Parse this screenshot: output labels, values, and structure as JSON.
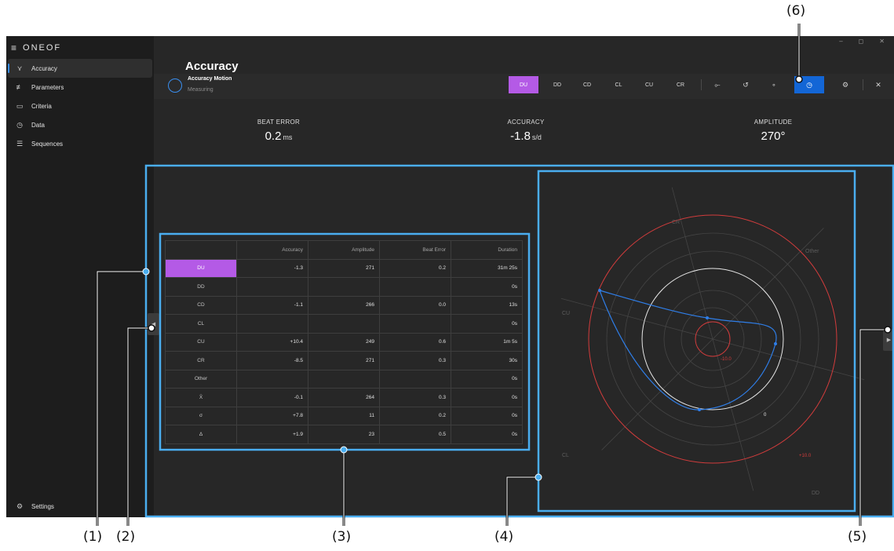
{
  "app": {
    "brand": "ONEOF"
  },
  "sidebar": {
    "items": [
      {
        "label": "Accuracy",
        "icon": "accuracy-icon",
        "active": true
      },
      {
        "label": "Parameters",
        "icon": "sliders-icon",
        "active": false
      },
      {
        "label": "Criteria",
        "icon": "monitor-icon",
        "active": false
      },
      {
        "label": "Data",
        "icon": "stopwatch-icon",
        "active": false
      },
      {
        "label": "Sequences",
        "icon": "list-icon",
        "active": false
      }
    ],
    "settings_label": "Settings"
  },
  "window_controls": [
    "–",
    "◻",
    "✕"
  ],
  "page": {
    "title": "Accuracy"
  },
  "header": {
    "motion_title": "Accuracy Motion",
    "motion_status": "Measuring",
    "positions": [
      "DU",
      "DD",
      "CD",
      "CL",
      "CU",
      "CR"
    ],
    "active_position": "DU",
    "tools": [
      "pin-icon",
      "history-icon",
      "dot-icon",
      "stopwatch-icon",
      "gear-icon",
      "close-icon"
    ]
  },
  "metrics": {
    "beat_error": {
      "label": "BEAT ERROR",
      "value": "0.2",
      "unit": "ms"
    },
    "accuracy": {
      "label": "ACCURACY",
      "value": "-1.8",
      "unit": "s/d"
    },
    "amplitude": {
      "label": "AMPLITUDE",
      "value": "270°",
      "unit": ""
    }
  },
  "table": {
    "headers": [
      "",
      "Accuracy",
      "Amplitude",
      "Beat Error",
      "Duration"
    ],
    "rows": [
      {
        "label": "DU",
        "accuracy": "-1.3",
        "amplitude": "271",
        "beat_error": "0.2",
        "duration": "31m 25s",
        "active": true
      },
      {
        "label": "DD",
        "accuracy": "",
        "amplitude": "",
        "beat_error": "",
        "duration": "0s"
      },
      {
        "label": "CD",
        "accuracy": "-1.1",
        "amplitude": "266",
        "beat_error": "0.0",
        "duration": "13s"
      },
      {
        "label": "CL",
        "accuracy": "",
        "amplitude": "",
        "beat_error": "",
        "duration": "0s"
      },
      {
        "label": "CU",
        "accuracy": "+10.4",
        "amplitude": "249",
        "beat_error": "0.6",
        "duration": "1m 5s"
      },
      {
        "label": "CR",
        "accuracy": "-8.5",
        "amplitude": "271",
        "beat_error": "0.3",
        "duration": "30s"
      },
      {
        "label": "Other",
        "accuracy": "",
        "amplitude": "",
        "beat_error": "",
        "duration": "0s"
      },
      {
        "label": "X̄",
        "accuracy": "-0.1",
        "amplitude": "264",
        "beat_error": "0.3",
        "duration": "0s"
      },
      {
        "label": "σ",
        "accuracy": "+7.8",
        "amplitude": "11",
        "beat_error": "0.2",
        "duration": "0s"
      },
      {
        "label": "Δ",
        "accuracy": "+1.9",
        "amplitude": "23",
        "beat_error": "0.5",
        "duration": "0s"
      }
    ]
  },
  "polar_chart": {
    "axes": [
      "CR",
      "Other",
      "CU",
      "CL",
      "DD"
    ],
    "ring_labels": {
      "inner": "-10.0",
      "zero": "0",
      "outer": "+10.0"
    },
    "colors": {
      "limit": "#d23c3c",
      "zero": "#e6e6e6",
      "trace": "#2f7ee8",
      "grid": "#444444"
    }
  },
  "callouts": [
    "(1)",
    "(2)",
    "(3)",
    "(4)",
    "(5)",
    "(6)"
  ],
  "colors": {
    "accent": "#b45ae6",
    "primary": "#1366d6",
    "highlight": "#3aa6f0"
  }
}
